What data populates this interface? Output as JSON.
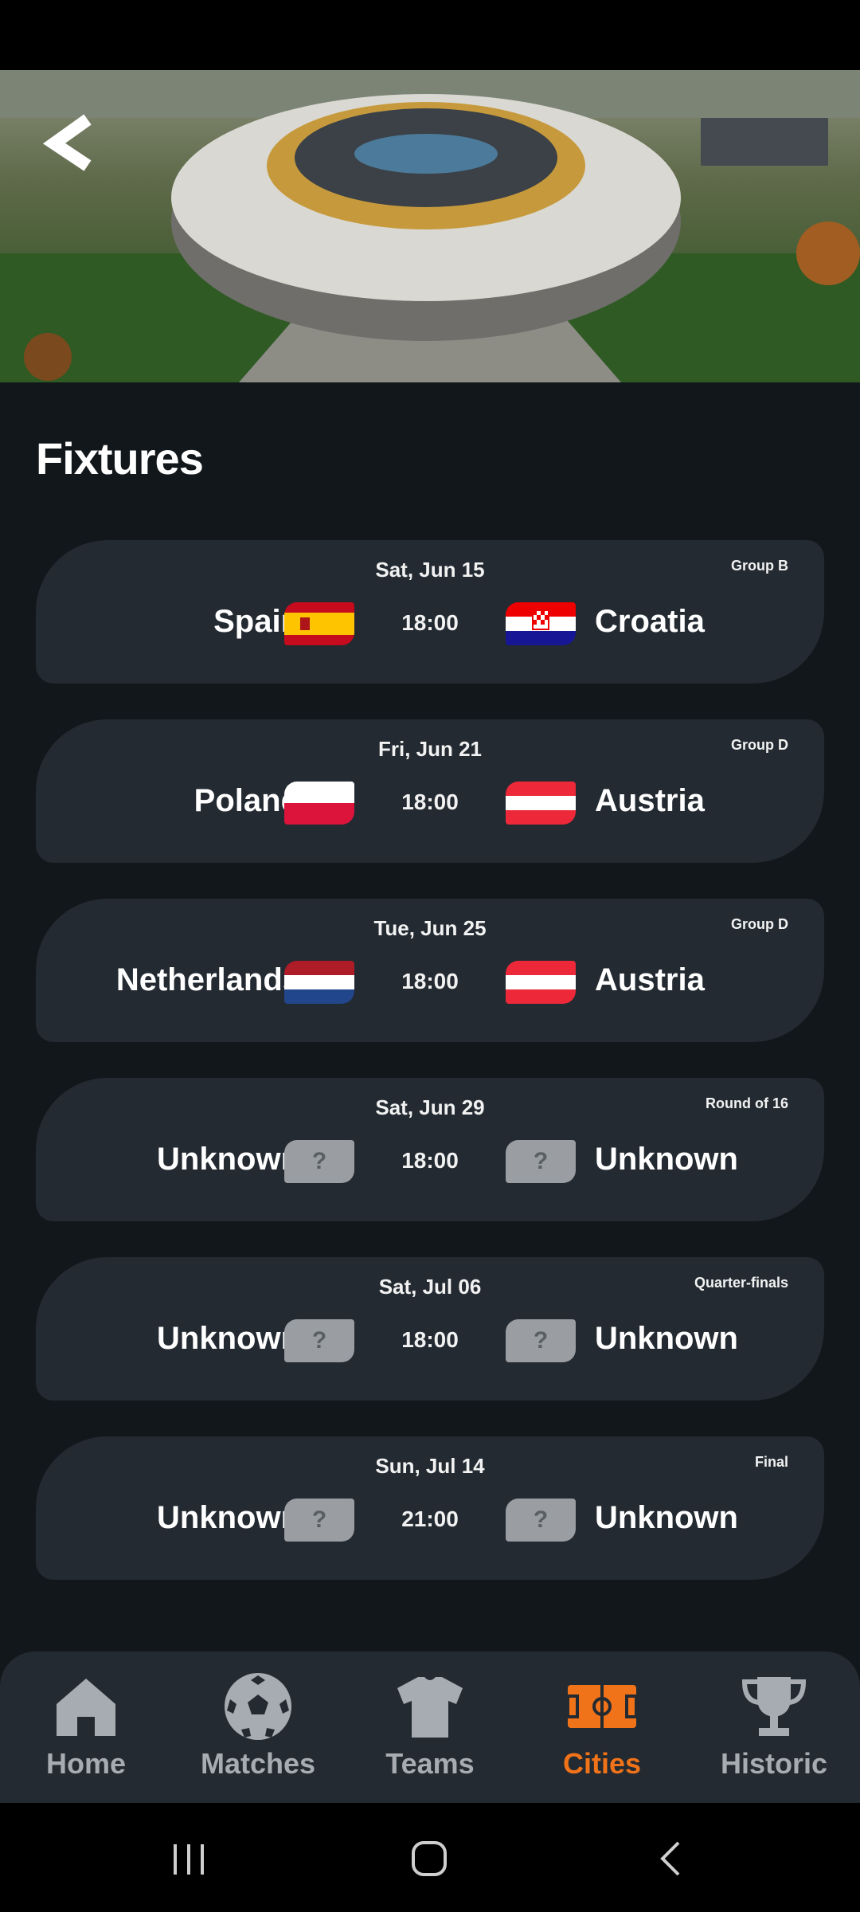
{
  "header": {
    "back_icon": "back-chevron-icon",
    "hero_image": "stadium-aerial-photo"
  },
  "section": {
    "title": "Fixtures"
  },
  "fixtures": [
    {
      "date": "Sat, Jun 15",
      "stage": "Group B",
      "home": "Spain",
      "away": "Croatia",
      "time": "18:00",
      "home_flag": "spain-flag-icon",
      "away_flag": "croatia-flag-icon"
    },
    {
      "date": "Fri, Jun 21",
      "stage": "Group D",
      "home": "Poland",
      "away": "Austria",
      "time": "18:00",
      "home_flag": "poland-flag-icon",
      "away_flag": "austria-flag-icon"
    },
    {
      "date": "Tue, Jun 25",
      "stage": "Group D",
      "home": "Netherlands",
      "away": "Austria",
      "time": "18:00",
      "home_flag": "netherlands-flag-icon",
      "away_flag": "austria-flag-icon"
    },
    {
      "date": "Sat, Jun 29",
      "stage": "Round of 16",
      "home": "Unknown",
      "away": "Unknown",
      "time": "18:00",
      "home_flag": "unknown-flag-icon",
      "away_flag": "unknown-flag-icon"
    },
    {
      "date": "Sat, Jul 06",
      "stage": "Quarter-finals",
      "home": "Unknown",
      "away": "Unknown",
      "time": "18:00",
      "home_flag": "unknown-flag-icon",
      "away_flag": "unknown-flag-icon"
    },
    {
      "date": "Sun, Jul 14",
      "stage": "Final",
      "home": "Unknown",
      "away": "Unknown",
      "time": "21:00",
      "home_flag": "unknown-flag-icon",
      "away_flag": "unknown-flag-icon"
    }
  ],
  "unknown_flag_text": "?",
  "bottom_nav": {
    "items": [
      {
        "label": "Home",
        "icon": "home-icon"
      },
      {
        "label": "Matches",
        "icon": "soccer-ball-icon"
      },
      {
        "label": "Teams",
        "icon": "jersey-icon"
      },
      {
        "label": "Cities",
        "icon": "stadium-field-icon",
        "active": true
      },
      {
        "label": "Historic",
        "icon": "trophy-icon"
      }
    ]
  },
  "colors": {
    "background": "#12171b",
    "card": "#232a31",
    "accent": "#f0731a",
    "inactive": "#a6acb1"
  }
}
